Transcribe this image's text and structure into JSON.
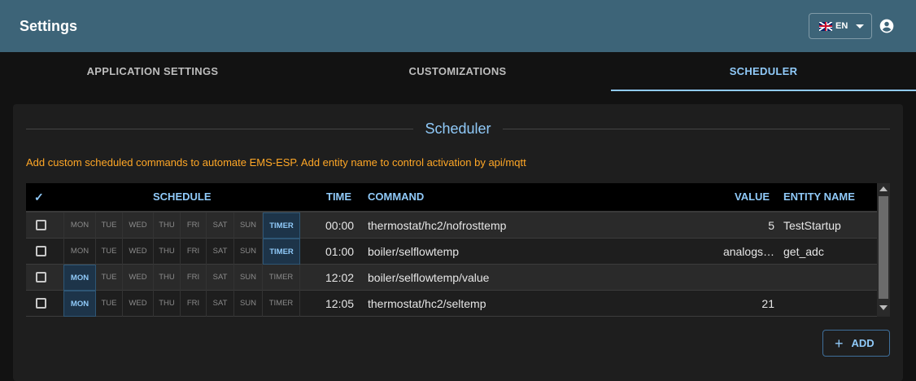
{
  "appbar": {
    "title": "Settings",
    "language": "EN"
  },
  "tabs": [
    {
      "label": "APPLICATION SETTINGS"
    },
    {
      "label": "CUSTOMIZATIONS"
    },
    {
      "label": "SCHEDULER"
    }
  ],
  "active_tab": "SCHEDULER",
  "scheduler": {
    "title": "Scheduler",
    "help": "Add custom scheduled commands to automate EMS-ESP. Add entity name to control activation by api/mqtt",
    "columns": {
      "check": "✓",
      "schedule": "SCHEDULE",
      "time": "TIME",
      "command": "COMMAND",
      "value": "VALUE",
      "name": "ENTITY NAME"
    },
    "days": [
      "MON",
      "TUE",
      "WED",
      "THU",
      "FRI",
      "SAT",
      "SUN",
      "TIMER"
    ],
    "rows": [
      {
        "active": [
          "TIMER"
        ],
        "time": "00:00",
        "command": "thermostat/hc2/nofrosttemp",
        "value": "5",
        "name": "TestStartup"
      },
      {
        "active": [
          "TIMER"
        ],
        "time": "01:00",
        "command": "boiler/selflowtemp",
        "value": "analogs…",
        "name": "get_adc"
      },
      {
        "active": [
          "MON"
        ],
        "time": "12:02",
        "command": "boiler/selflowtemp/value",
        "value": "",
        "name": ""
      },
      {
        "active": [
          "MON"
        ],
        "time": "12:05",
        "command": "thermostat/hc2/seltemp",
        "value": "21",
        "name": ""
      }
    ],
    "add_label": "ADD"
  },
  "colors": {
    "appbar": "#3d6478",
    "accent": "#90caf9",
    "help": "#ffa726"
  }
}
